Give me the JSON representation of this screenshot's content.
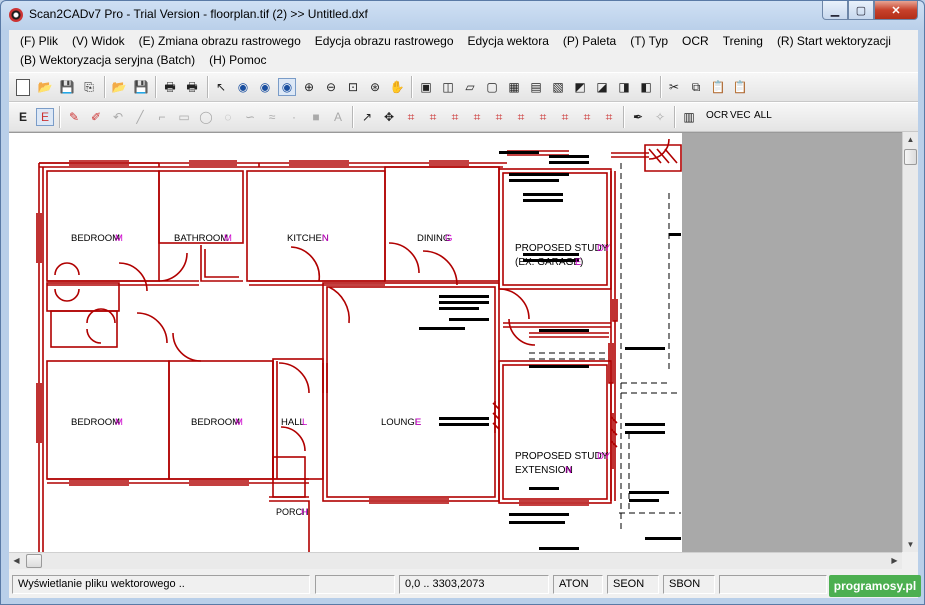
{
  "window": {
    "title": "Scan2CADv7 Pro - Trial Version  -  floorplan.tif (2) >> Untitled.dxf",
    "minimize": "▁",
    "maximize": "▢",
    "close": "✕"
  },
  "menu": {
    "row1": [
      "(F) Plik",
      "(V) Widok",
      "(E) Zmiana obrazu rastrowego",
      "Edycja obrazu rastrowego",
      "Edycja wektora",
      "(P) Paleta",
      "(T) Typ",
      "OCR",
      "Trening",
      "(R) Start wektoryzacji"
    ],
    "row2": [
      "(B) Wektoryzacja seryjna (Batch)",
      "(H) Pomoc"
    ]
  },
  "toolbar2": {
    "ocr": "OCR",
    "vec": "VEC",
    "all": "ALL"
  },
  "drawing": {
    "rooms": {
      "bedroom1": "BEDROOM",
      "bathroom": "BATHROOM",
      "kitchen": "KITCHEN",
      "dining": "DINING",
      "study_top_1": "PROPOSED STUDY",
      "study_top_2": "(EX. GARAGE)",
      "bedroom2": "BEDROOM",
      "bedroom3": "BEDROOM",
      "hall": "HALL",
      "lounge": "LOUNGE",
      "study_bottom_1": "PROPOSED STUDY",
      "study_bottom_2": "EXTENSION",
      "porch": "PORCH"
    },
    "ocr_suffix": {
      "bedroom1": "M",
      "bathroom": "M",
      "kitchen": "N",
      "dining": "G",
      "study_top": "DY",
      "study_top_2": "E",
      "bedroom2": "M",
      "bedroom3": "M",
      "hall": "L",
      "lounge": "E",
      "study_bottom": "DY",
      "study_bottom_2": "N",
      "porch": "H"
    },
    "colors": {
      "lines": "#b00000",
      "ocr": "#cc00cc",
      "text": "#000000"
    }
  },
  "status": {
    "message": "Wyświetlanie pliku wektorowego ..",
    "coords": "0,0 .. 3303,2073",
    "aton": "ATON",
    "seon": "SEON",
    "sbon": "SBON"
  },
  "watermark": "programosy.pl"
}
